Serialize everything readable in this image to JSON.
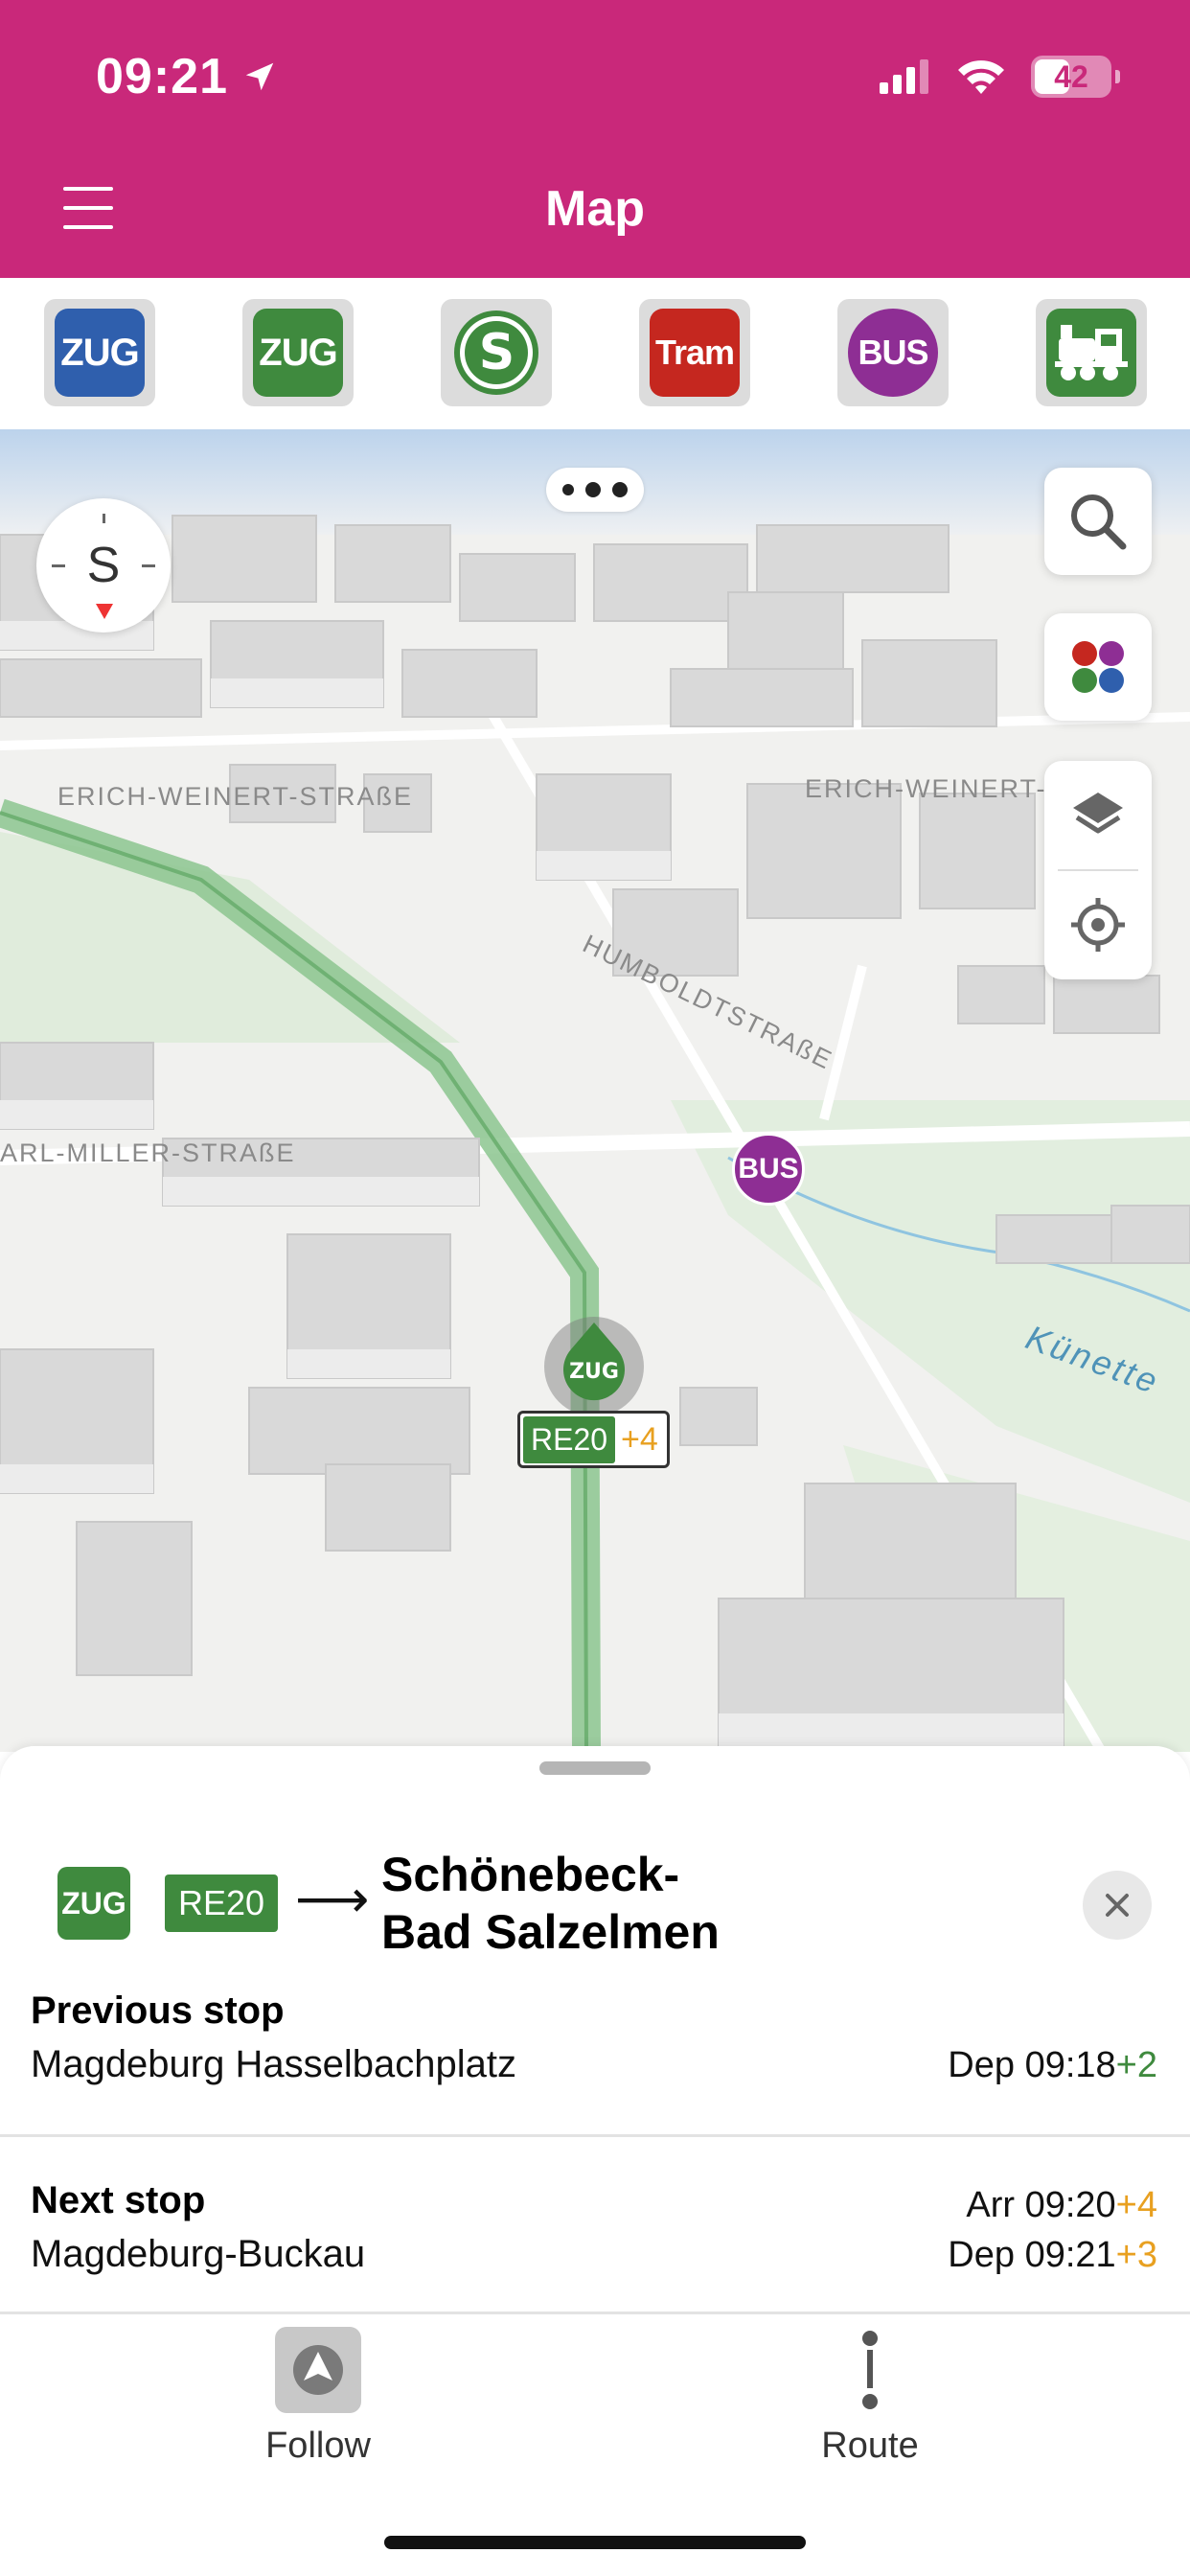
{
  "status_bar": {
    "time": "09:21",
    "battery": "42"
  },
  "header": {
    "title": "Map"
  },
  "filters": [
    {
      "label": "ZUG",
      "color": "#2f5fad",
      "name": "zug-regional"
    },
    {
      "label": "ZUG",
      "color": "#3f8a3e",
      "name": "zug-local"
    },
    {
      "label": "S",
      "color": "#3f8a3e",
      "name": "s-bahn"
    },
    {
      "label": "Tram",
      "color": "#c5271f",
      "name": "tram"
    },
    {
      "label": "BUS",
      "color": "#8e2e94",
      "name": "bus"
    },
    {
      "label": "steam-train",
      "color": "#3f8a3e",
      "name": "historic-train"
    }
  ],
  "map": {
    "compass_letter": "S",
    "streets": {
      "erich_left": "ERICH-WEINERT-STRAßE",
      "erich_right": "ERICH-WEINERT-",
      "humboldt": "HUMBOLDTSTRAßE",
      "miller": "ARL-MILLER-STRAßE"
    },
    "water": "Künette",
    "bus_stop_label": "BUS",
    "train_marker": {
      "chip": "ZUG",
      "line": "RE20",
      "delay": "+4"
    }
  },
  "journey": {
    "mode": "ZUG",
    "line": "RE20",
    "destination_line1": "Schönebeck-",
    "destination_line2": "Bad Salzelmen"
  },
  "previous_stop": {
    "title": "Previous stop",
    "name": "Magdeburg Hasselbachplatz",
    "dep_label": "Dep",
    "dep_time": "09:18",
    "dep_delay": "+2"
  },
  "next_stop": {
    "title": "Next stop",
    "name": "Magdeburg-Buckau",
    "arr_label": "Arr",
    "arr_time": "09:20",
    "arr_delay": "+4",
    "dep_label": "Dep",
    "dep_time": "09:21",
    "dep_delay": "+3"
  },
  "tabs": {
    "follow": "Follow",
    "route": "Route"
  },
  "colors": {
    "brand": "#c9287a",
    "train_green": "#3f8a3e",
    "delay_orange": "#e8a020",
    "bus_purple": "#8e2e94"
  }
}
